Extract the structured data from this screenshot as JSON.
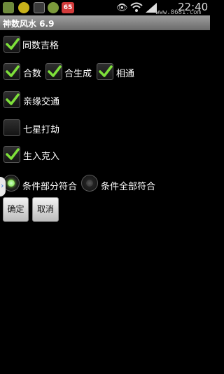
{
  "status_bar": {
    "time": "22:40",
    "watermark": "www.8681.com",
    "notification_badge": "65",
    "icons": [
      "app-icon-1",
      "app-icon-2",
      "gallery-icon",
      "app-icon-4",
      "notification-icon",
      "eye-icon",
      "wifi-icon",
      "signal-icon"
    ]
  },
  "app": {
    "title": "神数风水 6.9"
  },
  "options": {
    "tongshu_jige": {
      "label": "同数吉格",
      "checked": true
    },
    "heshu": {
      "label": "合数",
      "checked": true
    },
    "heshengcheng": {
      "label": "合生成",
      "checked": true
    },
    "xiangtong": {
      "label": "相通",
      "checked": true
    },
    "qinyuan_jiaotong": {
      "label": "亲缘交通",
      "checked": true
    },
    "qixing_dajie": {
      "label": "七星打劫",
      "checked": false
    },
    "shengru_keru": {
      "label": "生入克入",
      "checked": true
    }
  },
  "match_mode": {
    "options": [
      {
        "label": "条件部分符合",
        "selected": true
      },
      {
        "label": "条件全部符合",
        "selected": false
      }
    ]
  },
  "buttons": {
    "ok": "确定",
    "cancel": "取消"
  },
  "colors": {
    "check_green": "#7ee03a",
    "title_bar": "#8a8a8a"
  }
}
